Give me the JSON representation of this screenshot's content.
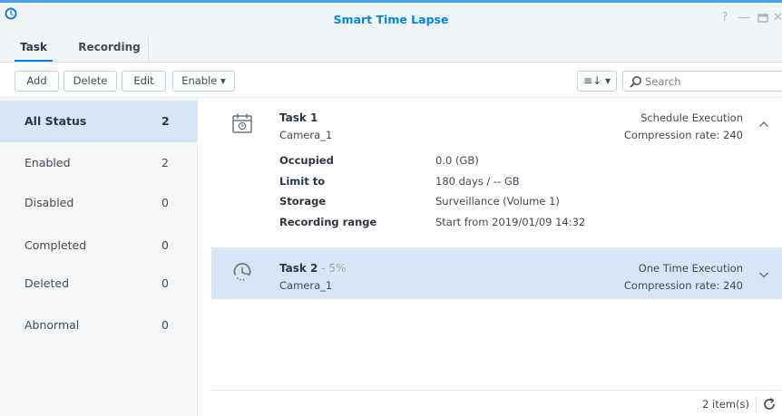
{
  "window": {
    "title": "Smart Time Lapse",
    "app_icon": "clock-icon",
    "controls": [
      "help-icon",
      "minimize-icon",
      "maximize-icon",
      "close-icon"
    ],
    "accent_color": "#0086e5"
  },
  "tabs": [
    {
      "label": "Task",
      "selected": true
    },
    {
      "label": "Recording",
      "selected": false
    }
  ],
  "toolbar": {
    "add_label": "Add",
    "delete_label": "Delete",
    "edit_label": "Edit",
    "enable_label": "Enable ▾",
    "sort_label": "≡↓ ▾",
    "search_placeholder": "Search"
  },
  "sidebar": {
    "items": [
      {
        "label": "All Status",
        "count": "2",
        "selected": true
      },
      {
        "label": "Enabled",
        "count": "2"
      },
      {
        "label": "Disabled",
        "count": "0"
      },
      {
        "label": "Completed",
        "count": "0"
      },
      {
        "label": "Deleted",
        "count": "0"
      },
      {
        "label": "Abnormal",
        "count": "0"
      }
    ]
  },
  "tasks": [
    {
      "name": "Task 1",
      "progress": "",
      "camera": "Camera_1",
      "type": "Schedule Execution",
      "compression": "Compression rate: 240",
      "icon": "calendar-clock-icon",
      "expanded": true,
      "details": [
        {
          "label": "Occupied",
          "value": "0.0 (GB)"
        },
        {
          "label": "Limit to",
          "value": "180 days / -- GB"
        },
        {
          "label": "Storage",
          "value": "Surveillance (Volume 1)"
        },
        {
          "label": "Recording range",
          "value": "Start from 2019/01/09 14:32"
        }
      ]
    },
    {
      "name": "Task 2",
      "progress": " - 5%",
      "camera": "Camera_1",
      "type": "One Time Execution",
      "compression": "Compression rate: 240",
      "icon": "timelapse-icon",
      "expanded": false
    }
  ],
  "footer": {
    "item_count": "2 item(s)"
  }
}
